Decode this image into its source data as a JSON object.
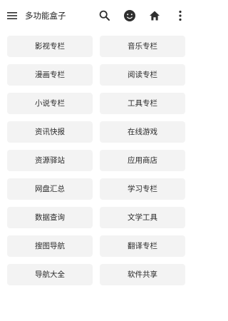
{
  "app": {
    "title": "多功能盒子"
  },
  "toolbar": {
    "menu_icon": "menu-icon",
    "search_icon": "search-icon",
    "face_icon": "face-icon",
    "home_icon": "home-icon",
    "more_icon": "more-vertical-icon"
  },
  "buttons": [
    "影视专栏",
    "音乐专栏",
    "漫画专栏",
    "阅读专栏",
    "小说专栏",
    "工具专栏",
    "资讯快报",
    "在线游戏",
    "资源驿站",
    "应用商店",
    "网盘汇总",
    "学习专栏",
    "数据查询",
    "文学工具",
    "搜图导航",
    "翻译专栏",
    "导航大全",
    "软件共享"
  ],
  "colors": {
    "button_bg": "#f3f3f3",
    "text": "#2a2a2a",
    "icon": "#2f2f2f"
  }
}
